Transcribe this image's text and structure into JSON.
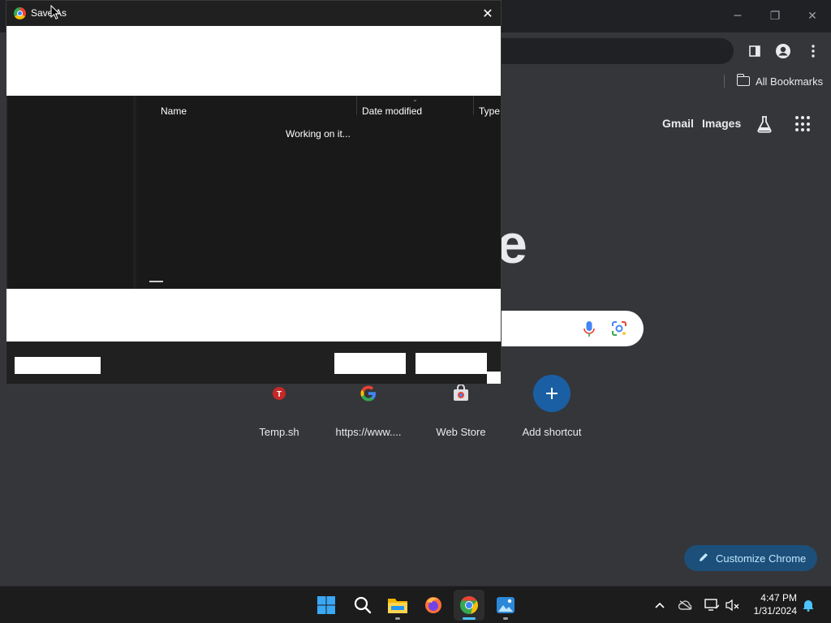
{
  "chrome": {
    "window_controls": [
      "─",
      "❐",
      "✕"
    ],
    "bookmarks_bar": {
      "all_bookmarks": "All Bookmarks"
    },
    "ntp": {
      "links": [
        "Gmail",
        "Images"
      ],
      "logo_fragment": "e",
      "shortcuts": [
        {
          "label": "Temp.sh",
          "icon": "T",
          "color": "#e53935"
        },
        {
          "label": "https://www....",
          "icon": "G",
          "color": "#4285f4"
        },
        {
          "label": "Web Store",
          "icon": "store",
          "color": "#f1c40f"
        },
        {
          "label": "Add shortcut",
          "icon": "+",
          "color": "#1a73e8"
        }
      ],
      "customize_label": "Customize Chrome"
    }
  },
  "dialog": {
    "title": "Save As",
    "close_glyph": "✕",
    "columns": [
      "Name",
      "Date modified",
      "Type"
    ],
    "status": "Working on it..."
  },
  "taskbar": {
    "time": "4:47 PM",
    "date": "1/31/2024",
    "apps": [
      "start",
      "search",
      "file-explorer",
      "firefox",
      "chrome",
      "photos"
    ]
  },
  "colors": {
    "chrome_bg": "#35363a",
    "tabstrip": "#202124",
    "dialog_bg": "#202020",
    "accent_blue": "#4cc2ff",
    "add_shortcut": "#1a73e8"
  }
}
